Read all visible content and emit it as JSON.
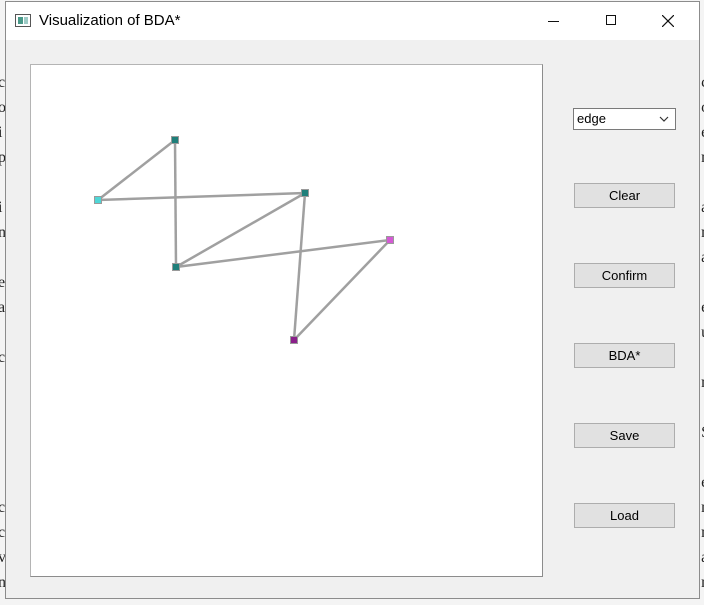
{
  "window": {
    "title": "Visualization of BDA*",
    "controls": [
      "minimize",
      "maximize",
      "close"
    ]
  },
  "controls": {
    "mode_select": {
      "selected": "edge"
    },
    "buttons": {
      "clear": "Clear",
      "confirm": "Confirm",
      "bda": "BDA*",
      "save": "Save",
      "load": "Load"
    }
  },
  "graph": {
    "nodes": [
      {
        "id": "n1",
        "color": "#1f7f7a"
      },
      {
        "id": "n2",
        "color": "#4fd6d6"
      },
      {
        "id": "n3",
        "color": "#1f7f7a"
      },
      {
        "id": "n4",
        "color": "#1f7f7a"
      },
      {
        "id": "n5",
        "color": "#d45ad4"
      },
      {
        "id": "n6",
        "color": "#8a1f8a"
      }
    ],
    "edges": [
      [
        "n1",
        "n2"
      ],
      [
        "n1",
        "n4"
      ],
      [
        "n2",
        "n3"
      ],
      [
        "n3",
        "n4"
      ],
      [
        "n3",
        "n6"
      ],
      [
        "n4",
        "n5"
      ],
      [
        "n5",
        "n6"
      ]
    ],
    "edge_color": "#a0a0a0"
  }
}
